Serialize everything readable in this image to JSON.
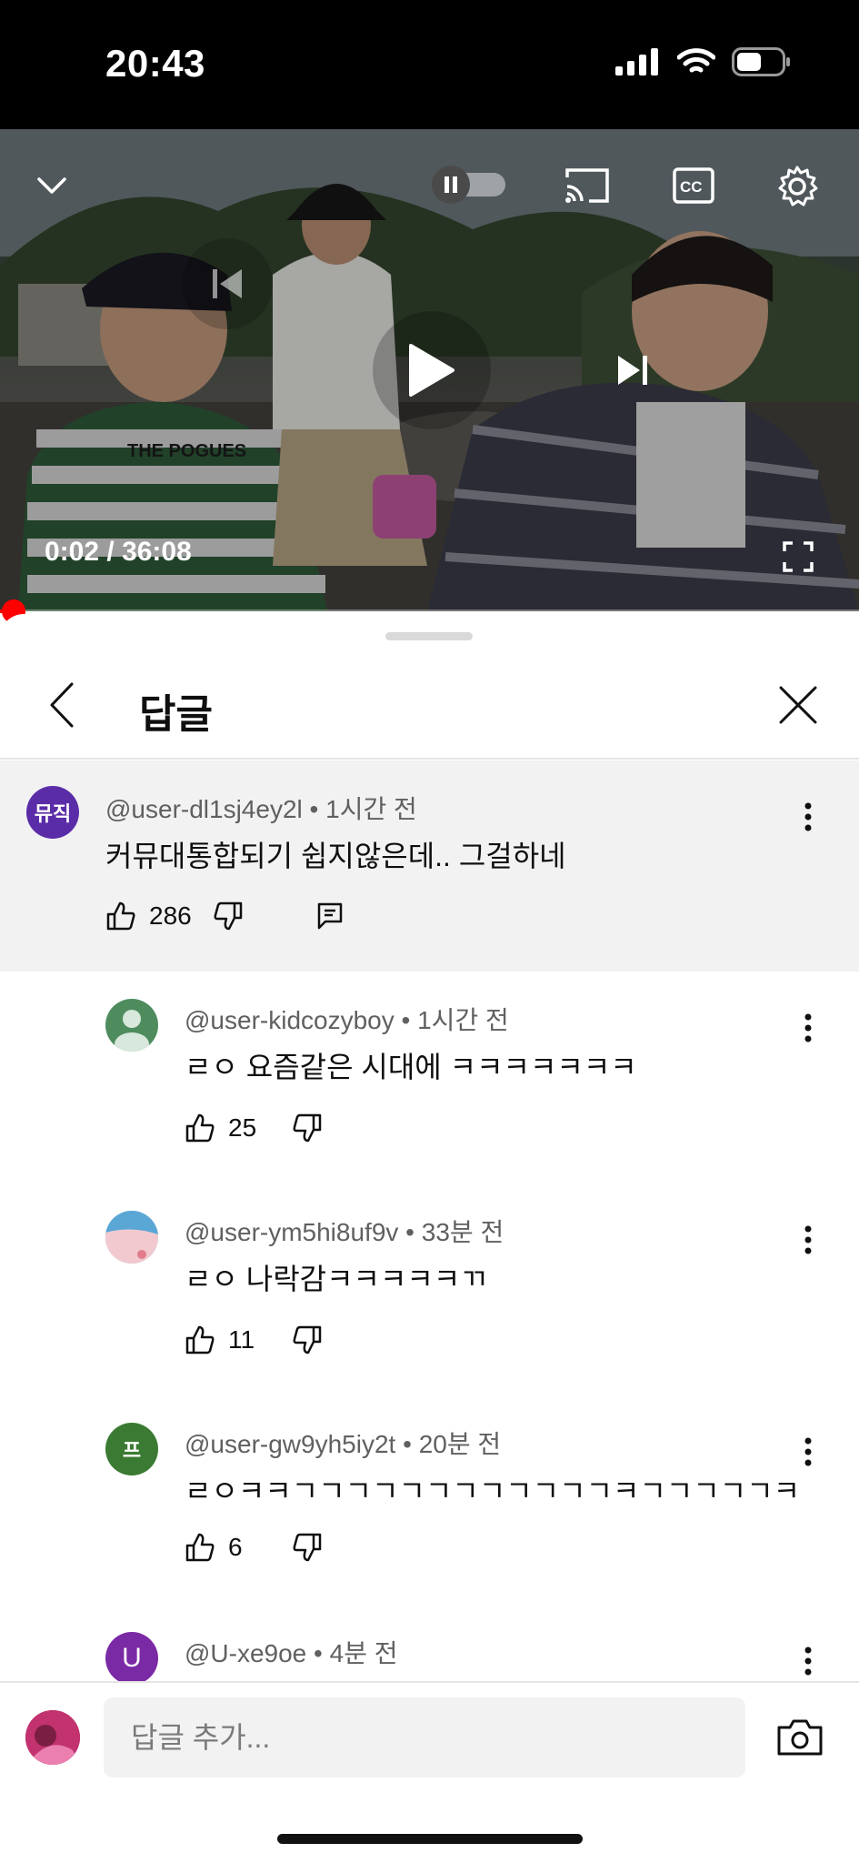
{
  "status_bar": {
    "time": "20:43",
    "battery_icon": "battery-icon",
    "wifi_icon": "wifi-icon",
    "signal_icon": "cellular-signal-icon"
  },
  "player": {
    "time_current": "0:02",
    "time_separator": " / ",
    "time_total": "36:08",
    "progress_fraction": 0.001,
    "shirt_text": "THE POGUES",
    "accent_color": "#ff0000"
  },
  "sheet": {
    "title": "답글",
    "back_icon": "chevron-left-icon",
    "close_icon": "close-icon"
  },
  "parent_comment": {
    "avatar_text": "뮤직",
    "avatar_color": "#5b2ca8",
    "username": "@user-dl1sj4ey2l",
    "time": "1시간 전",
    "text": "커뮤대통합되기 쉽지않은데.. 그걸하네",
    "likes": "286"
  },
  "replies": [
    {
      "avatar_text": "",
      "avatar_color": "#4e8c5d",
      "username": "@user-kidcozyboy",
      "time": "1시간 전",
      "text": "ㄹㅇ 요즘같은 시대에 ㅋㅋㅋㅋㅋㅋㅋ",
      "likes": "25"
    },
    {
      "avatar_text": "",
      "avatar_color": "#5aa7d6",
      "username": "@user-ym5hi8uf9v",
      "time": "33분 전",
      "text": "ㄹㅇ 나락감ㅋㅋㅋㅋㅋㄲ",
      "likes": "11"
    },
    {
      "avatar_text": "프",
      "avatar_color": "#3b7a32",
      "username": "@user-gw9yh5iy2t",
      "time": "20분 전",
      "text": "ㄹㅇㅋㅋㄱㄱㄱㄱㄱㄱㄱㄱㄱㄱㄱㄱㅋㄱㄱㄱㄱㄱㅋ",
      "likes": "6"
    },
    {
      "avatar_text": "U",
      "avatar_color": "#7b2aa5",
      "username": "@U-xe9oe",
      "time": "4분 전",
      "text": "",
      "likes": ""
    }
  ],
  "composer": {
    "placeholder": "답글 추가...",
    "camera_icon": "camera-icon"
  }
}
